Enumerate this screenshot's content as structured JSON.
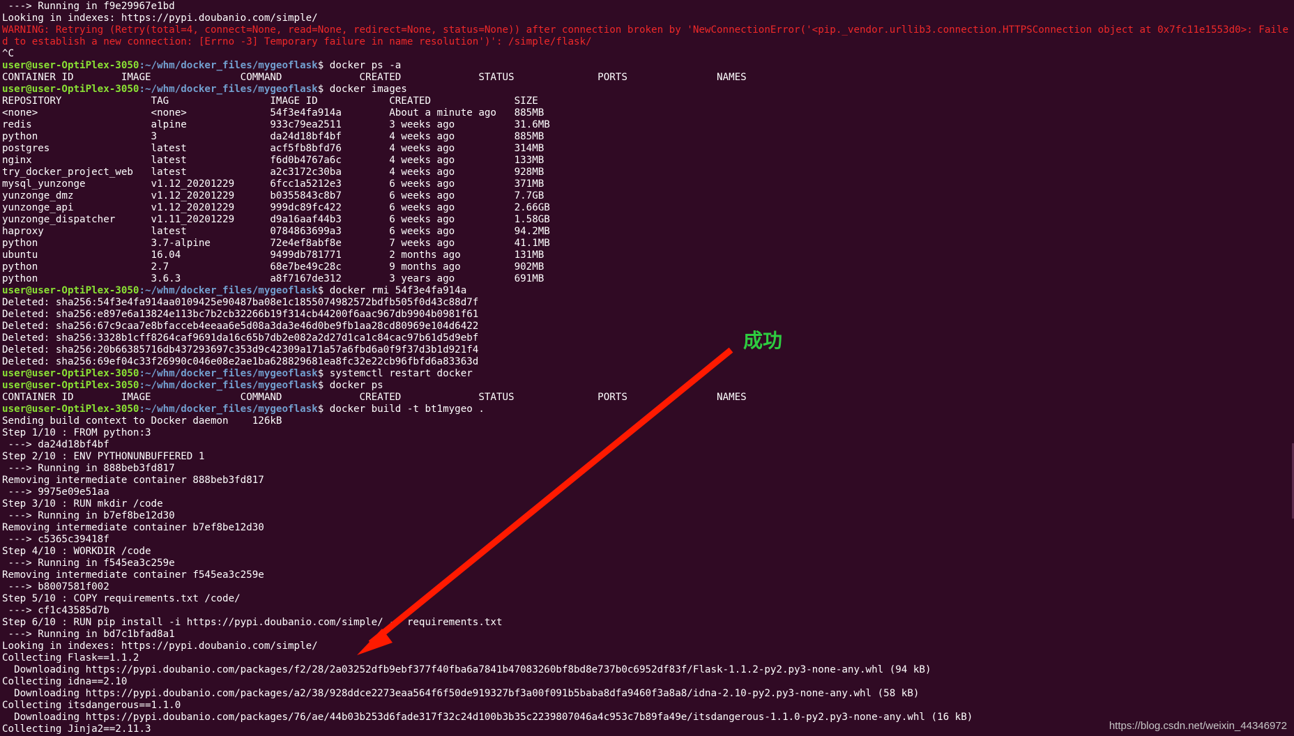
{
  "prompt": {
    "user_host": "user@user-OptiPlex-3050",
    "path": ":~/whm/docker_files/mygeoflask"
  },
  "lines": [
    {
      "kind": "out",
      "text": " ---> Running in f9e29967e1bd"
    },
    {
      "kind": "out",
      "text": "Looking in indexes: https://pypi.doubanio.com/simple/"
    },
    {
      "kind": "warn",
      "text": "WARNING: Retrying (Retry(total=4, connect=None, read=None, redirect=None, status=None)) after connection broken by 'NewConnectionError('<pip._vendor.urllib3.connection.HTTPSConnection object at 0x7fc11e1553d0>: Failed to establish a new connection: [Errno -3] Temporary failure in name resolution')': /simple/flask/"
    },
    {
      "kind": "out",
      "text": "^C"
    },
    {
      "kind": "cmd",
      "text": "$ docker ps -a"
    },
    {
      "kind": "out",
      "text": "CONTAINER ID        IMAGE               COMMAND             CREATED             STATUS              PORTS               NAMES"
    },
    {
      "kind": "cmd",
      "text": "$ docker images"
    },
    {
      "kind": "out",
      "text": "REPOSITORY               TAG                 IMAGE ID            CREATED              SIZE"
    },
    {
      "kind": "out",
      "text": "<none>                   <none>              54f3e4fa914a        About a minute ago   885MB"
    },
    {
      "kind": "out",
      "text": "redis                    alpine              933c79ea2511        3 weeks ago          31.6MB"
    },
    {
      "kind": "out",
      "text": "python                   3                   da24d18bf4bf        4 weeks ago          885MB"
    },
    {
      "kind": "out",
      "text": "postgres                 latest              acf5fb8bfd76        4 weeks ago          314MB"
    },
    {
      "kind": "out",
      "text": "nginx                    latest              f6d0b4767a6c        4 weeks ago          133MB"
    },
    {
      "kind": "out",
      "text": "try_docker_project_web   latest              a2c3172c30ba        4 weeks ago          928MB"
    },
    {
      "kind": "out",
      "text": "mysql_yunzonge           v1.12_20201229      6fcc1a5212e3        6 weeks ago          371MB"
    },
    {
      "kind": "out",
      "text": "yunzonge_dmz             v1.12_20201229      b0355843c8b7        6 weeks ago          7.7GB"
    },
    {
      "kind": "out",
      "text": "yunzonge_api             v1.12_20201229      999dc89fc422        6 weeks ago          2.66GB"
    },
    {
      "kind": "out",
      "text": "yunzonge_dispatcher      v1.11_20201229      d9a16aaf44b3        6 weeks ago          1.58GB"
    },
    {
      "kind": "out",
      "text": "haproxy                  latest              0784863699a3        6 weeks ago          94.2MB"
    },
    {
      "kind": "out",
      "text": "python                   3.7-alpine          72e4ef8abf8e        7 weeks ago          41.1MB"
    },
    {
      "kind": "out",
      "text": "ubuntu                   16.04               9499db781771        2 months ago         131MB"
    },
    {
      "kind": "out",
      "text": "python                   2.7                 68e7be49c28c        9 months ago         902MB"
    },
    {
      "kind": "out",
      "text": "python                   3.6.3               a8f7167de312        3 years ago          691MB"
    },
    {
      "kind": "cmd",
      "text": "$ docker rmi 54f3e4fa914a"
    },
    {
      "kind": "out",
      "text": "Deleted: sha256:54f3e4fa914aa0109425e90487ba08e1c1855074982572bdfb505f0d43c88d7f"
    },
    {
      "kind": "out",
      "text": "Deleted: sha256:e897e6a13824e113bc7b2cb32266b19f314cb44200f6aac967db9904b0981f61"
    },
    {
      "kind": "out",
      "text": "Deleted: sha256:67c9caa7e8bfacceb4eeaa6e5d08a3da3e46d0be9fb1aa28cd80969e104d6422"
    },
    {
      "kind": "out",
      "text": "Deleted: sha256:3328b1cff8264caf9691da16c65b7db2e082a2d27d1ca1c84cac97b61d5d9ebf"
    },
    {
      "kind": "out",
      "text": "Deleted: sha256:20b66385716db437293697c353d9c42309a171a57a6fbd6a0f9f37d3b1d921f4"
    },
    {
      "kind": "out",
      "text": "Deleted: sha256:69ef04c33f26990c046e08e2ae1ba628829681ea8fc32e22cb96fbfd6a83363d"
    },
    {
      "kind": "cmd",
      "text": "$ systemctl restart docker"
    },
    {
      "kind": "cmd",
      "text": "$ docker ps"
    },
    {
      "kind": "out",
      "text": "CONTAINER ID        IMAGE               COMMAND             CREATED             STATUS              PORTS               NAMES"
    },
    {
      "kind": "cmd",
      "text": "$ docker build -t bt1mygeo ."
    },
    {
      "kind": "out",
      "text": "Sending build context to Docker daemon    126kB"
    },
    {
      "kind": "out",
      "text": "Step 1/10 : FROM python:3"
    },
    {
      "kind": "out",
      "text": " ---> da24d18bf4bf"
    },
    {
      "kind": "out",
      "text": "Step 2/10 : ENV PYTHONUNBUFFERED 1"
    },
    {
      "kind": "out",
      "text": " ---> Running in 888beb3fd817"
    },
    {
      "kind": "out",
      "text": "Removing intermediate container 888beb3fd817"
    },
    {
      "kind": "out",
      "text": " ---> 9975e09e51aa"
    },
    {
      "kind": "out",
      "text": "Step 3/10 : RUN mkdir /code"
    },
    {
      "kind": "out",
      "text": " ---> Running in b7ef8be12d30"
    },
    {
      "kind": "out",
      "text": "Removing intermediate container b7ef8be12d30"
    },
    {
      "kind": "out",
      "text": " ---> c5365c39418f"
    },
    {
      "kind": "out",
      "text": "Step 4/10 : WORKDIR /code"
    },
    {
      "kind": "out",
      "text": " ---> Running in f545ea3c259e"
    },
    {
      "kind": "out",
      "text": "Removing intermediate container f545ea3c259e"
    },
    {
      "kind": "out",
      "text": " ---> b8007581f002"
    },
    {
      "kind": "out",
      "text": "Step 5/10 : COPY requirements.txt /code/"
    },
    {
      "kind": "out",
      "text": " ---> cf1c43585d7b"
    },
    {
      "kind": "out",
      "text": "Step 6/10 : RUN pip install -i https://pypi.doubanio.com/simple/ -r requirements.txt"
    },
    {
      "kind": "out",
      "text": " ---> Running in bd7c1bfad8a1"
    },
    {
      "kind": "out",
      "text": "Looking in indexes: https://pypi.doubanio.com/simple/"
    },
    {
      "kind": "out",
      "text": "Collecting Flask==1.1.2"
    },
    {
      "kind": "out",
      "text": "  Downloading https://pypi.doubanio.com/packages/f2/28/2a03252dfb9ebf377f40fba6a7841b47083260bf8bd8e737b0c6952df83f/Flask-1.1.2-py2.py3-none-any.whl (94 kB)"
    },
    {
      "kind": "out",
      "text": "Collecting idna==2.10"
    },
    {
      "kind": "out",
      "text": "  Downloading https://pypi.doubanio.com/packages/a2/38/928ddce2273eaa564f6f50de919327bf3a00f091b5baba8dfa9460f3a8a8/idna-2.10-py2.py3-none-any.whl (58 kB)"
    },
    {
      "kind": "out",
      "text": "Collecting itsdangerous==1.1.0"
    },
    {
      "kind": "out",
      "text": "  Downloading https://pypi.doubanio.com/packages/76/ae/44b03b253d6fade317f32c24d100b3b35c2239807046a4c953c7b89fa49e/itsdangerous-1.1.0-py2.py3-none-any.whl (16 kB)"
    },
    {
      "kind": "out",
      "text": "Collecting Jinja2==2.11.3"
    }
  ],
  "annotation": {
    "label": "成功",
    "color": "#2ecc40",
    "arrow_color": "#ff1a00"
  },
  "watermark": "https://blog.csdn.net/weixin_44346972",
  "colors": {
    "background": "#300a24",
    "text": "#ffffff",
    "user": "#8ae234",
    "path": "#729fcf",
    "warning": "#ef2929"
  }
}
